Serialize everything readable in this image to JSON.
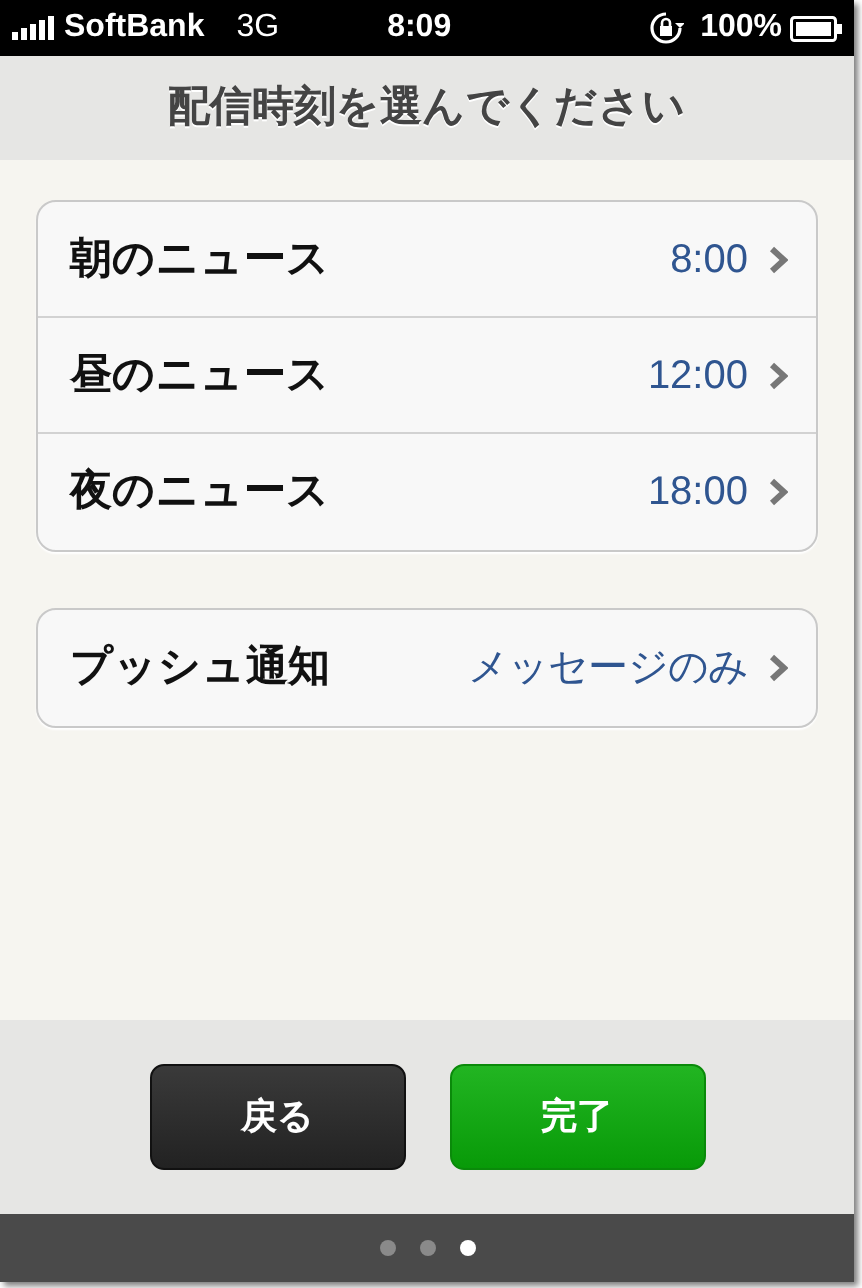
{
  "status_bar": {
    "carrier": "SoftBank",
    "network": "3G",
    "time": "8:09",
    "battery": "100%"
  },
  "title": "配信時刻を選んでください",
  "groups": [
    {
      "rows": [
        {
          "label": "朝のニュース",
          "value": "8:00"
        },
        {
          "label": "昼のニュース",
          "value": "12:00"
        },
        {
          "label": "夜のニュース",
          "value": "18:00"
        }
      ]
    },
    {
      "rows": [
        {
          "label": "プッシュ通知",
          "value": "メッセージのみ"
        }
      ]
    }
  ],
  "buttons": [
    {
      "label": "戻る",
      "kind": "back"
    },
    {
      "label": "完了",
      "kind": "done"
    }
  ],
  "page_dots": [
    {
      "selected": false
    },
    {
      "selected": false
    },
    {
      "selected": true
    }
  ]
}
